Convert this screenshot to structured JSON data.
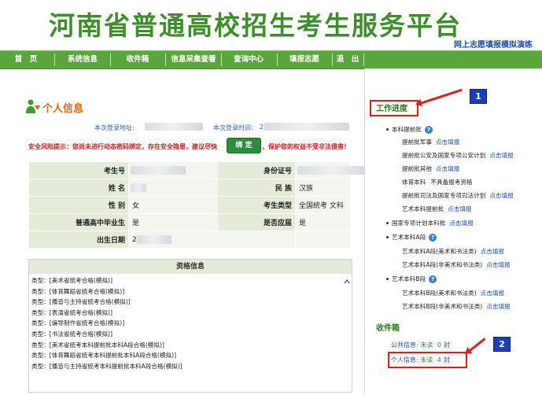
{
  "site": {
    "title": "河南省普通高校招生考生服务平台",
    "practice_link": "网上志愿填报模拟演练"
  },
  "nav": [
    "首　页",
    "系统信息",
    "收件箱",
    "信息采集查看",
    "查询中心",
    "填报志愿",
    "退　出"
  ],
  "page": {
    "title": "个人信息",
    "login_addr_label": "本次登录地址:",
    "login_time_label": "本次登录时间：",
    "login_time_value": "2",
    "warning": "安全风险提示：您尚未进行动态密码绑定，存在安全隐患，建议尽快",
    "bind_button": "绑 定",
    "warning_tail": "，保护您的权益不受非法侵害！"
  },
  "info": {
    "kaoshenghao_label": "考生号",
    "idcard_label": "身份证号",
    "name_label": "姓 名",
    "minzu_label": "民 族",
    "minzu_value": "汉族",
    "gender_label": "性 别",
    "gender_value": "女",
    "type_label": "考生类型",
    "type_value": "全国统考 文科",
    "graduate_label": "普通高中毕业生",
    "graduate_value": "是",
    "current_label": "是否应届",
    "current_value": "是",
    "birth_label": "出生日期",
    "birth_value": "2"
  },
  "qualifications": {
    "header": "资格信息",
    "items": [
      "类型：[美术省统考合格(模拟)]",
      "类型：[体育舞蹈省统考合格(模拟)]",
      "类型：[播音与主持省统考合格(模拟)]",
      "类型：[表演省统考合格(模拟)]",
      "类型：[编导制作省统考合格(模拟)]",
      "类型：[书法省统考合格(模拟)]",
      "类型：[美术省统考本科提前批本科A段合格(模拟)]",
      "类型：[体育舞蹈省统考本科提前批本科A段合格(模拟)]",
      "类型：[播音与主持省统考本科提前批本科A段合格(模拟)]"
    ]
  },
  "progress": {
    "title": "工作进度",
    "benke_tiqian": "本科提前批",
    "items": [
      {
        "label": "提前批军事",
        "link": "点击填报"
      },
      {
        "label": "提前批公安及国家专项公安计划",
        "link": "点击填报"
      },
      {
        "label": "提前批其他",
        "link": "点击填报"
      },
      {
        "label": "体育本科",
        "extra": "不具备报考资格"
      },
      {
        "label": "提前批司法及国家专项司法计划",
        "link": "点击填报"
      },
      {
        "label": "艺术本科提前批",
        "link": "点击填报"
      }
    ],
    "guojia": {
      "label": "国家专项计划本科批",
      "link": "点击填报"
    },
    "yishu_a": "艺术本科A段",
    "a_items": [
      {
        "label": "艺术本科A段(美术和书法类)",
        "link": "点击填报"
      },
      {
        "label": "艺术本科A段(非美术和书法类)",
        "link": "点击填报"
      }
    ],
    "yishu_b": "艺术本科B段",
    "b_items": [
      {
        "label": "艺术本科B段(美术和书法类)",
        "link": "点击填报"
      },
      {
        "label": "艺术本科B段(非美术和书法类)",
        "link": "点击填报"
      }
    ]
  },
  "inbox": {
    "title": "收件箱",
    "public_label": "公共信息:",
    "public_status": "未读",
    "public_count": "0",
    "public_unit": "封",
    "personal_label": "个人信息:",
    "personal_status": "未读",
    "personal_count": "4",
    "personal_unit": "封"
  },
  "help_glyph": "?",
  "badges": {
    "b1": "1",
    "b2": "2"
  },
  "colors": {
    "brand_green": "#5aa53c",
    "title_green": "#3e8f2b",
    "accent_orange": "#e06a17",
    "alert_red": "#e02020",
    "link_blue": "#1a50b0"
  }
}
